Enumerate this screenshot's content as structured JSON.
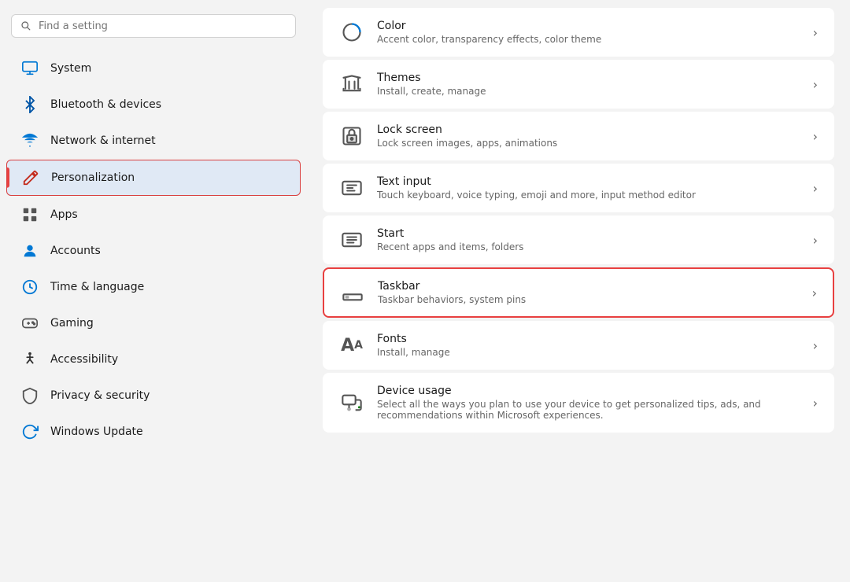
{
  "search": {
    "placeholder": "Find a setting"
  },
  "sidebar": {
    "items": [
      {
        "id": "system",
        "label": "System",
        "icon": "monitor"
      },
      {
        "id": "bluetooth",
        "label": "Bluetooth & devices",
        "icon": "bluetooth"
      },
      {
        "id": "network",
        "label": "Network & internet",
        "icon": "network"
      },
      {
        "id": "personalization",
        "label": "Personalization",
        "icon": "personalization",
        "active": true
      },
      {
        "id": "apps",
        "label": "Apps",
        "icon": "apps"
      },
      {
        "id": "accounts",
        "label": "Accounts",
        "icon": "accounts"
      },
      {
        "id": "time",
        "label": "Time & language",
        "icon": "time"
      },
      {
        "id": "gaming",
        "label": "Gaming",
        "icon": "gaming"
      },
      {
        "id": "accessibility",
        "label": "Accessibility",
        "icon": "accessibility"
      },
      {
        "id": "privacy",
        "label": "Privacy & security",
        "icon": "privacy"
      },
      {
        "id": "update",
        "label": "Windows Update",
        "icon": "update"
      }
    ]
  },
  "main": {
    "items": [
      {
        "id": "color",
        "title": "Color",
        "desc": "Accent color, transparency effects, color theme",
        "highlighted": false
      },
      {
        "id": "themes",
        "title": "Themes",
        "desc": "Install, create, manage",
        "highlighted": false
      },
      {
        "id": "lockscreen",
        "title": "Lock screen",
        "desc": "Lock screen images, apps, animations",
        "highlighted": false
      },
      {
        "id": "textinput",
        "title": "Text input",
        "desc": "Touch keyboard, voice typing, emoji and more, input method editor",
        "highlighted": false
      },
      {
        "id": "start",
        "title": "Start",
        "desc": "Recent apps and items, folders",
        "highlighted": false
      },
      {
        "id": "taskbar",
        "title": "Taskbar",
        "desc": "Taskbar behaviors, system pins",
        "highlighted": true
      },
      {
        "id": "fonts",
        "title": "Fonts",
        "desc": "Install, manage",
        "highlighted": false
      },
      {
        "id": "deviceusage",
        "title": "Device usage",
        "desc": "Select all the ways you plan to use your device to get personalized tips, ads, and recommendations within Microsoft experiences.",
        "highlighted": false
      }
    ]
  }
}
